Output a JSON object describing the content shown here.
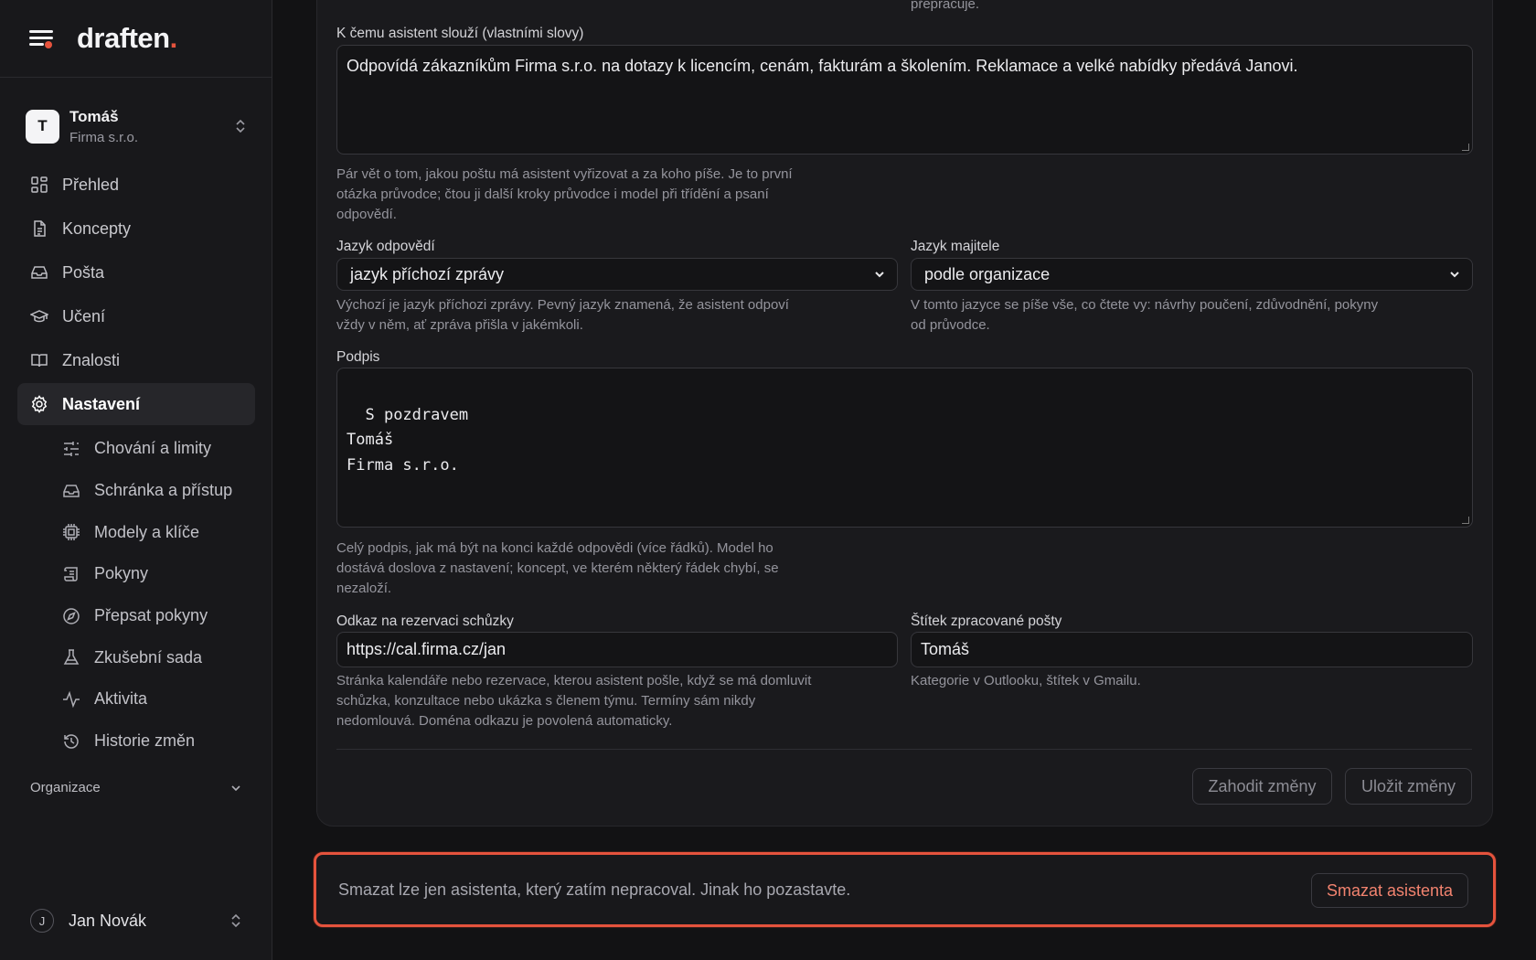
{
  "brand": {
    "name": "draften",
    "dot": "."
  },
  "account": {
    "initial": "T",
    "name": "Tomáš",
    "org": "Firma s.r.o."
  },
  "nav": [
    {
      "label": "Přehled",
      "icon": "dashboard-icon"
    },
    {
      "label": "Koncepty",
      "icon": "document-icon"
    },
    {
      "label": "Pošta",
      "icon": "inbox-icon"
    },
    {
      "label": "Učení",
      "icon": "graduation-cap-icon"
    },
    {
      "label": "Znalosti",
      "icon": "book-icon"
    },
    {
      "label": "Nastavení",
      "icon": "gear-icon",
      "active": true
    }
  ],
  "settings_sub": [
    {
      "label": "Chování a limity",
      "icon": "sliders-icon"
    },
    {
      "label": "Schránka a přístup",
      "icon": "inbox-icon"
    },
    {
      "label": "Modely a klíče",
      "icon": "chip-icon"
    },
    {
      "label": "Pokyny",
      "icon": "scroll-icon"
    },
    {
      "label": "Přepsat pokyny",
      "icon": "compass-icon"
    },
    {
      "label": "Zkušební sada",
      "icon": "flask-icon"
    },
    {
      "label": "Aktivita",
      "icon": "activity-icon"
    },
    {
      "label": "Historie změn",
      "icon": "history-icon"
    }
  ],
  "org_section": {
    "label": "Organizace"
  },
  "user": {
    "initial": "J",
    "name": "Jan Novák"
  },
  "form": {
    "top_fragment": "přepracuje.",
    "purpose": {
      "label": "K čemu asistent slouží (vlastními slovy)",
      "value": "Odpovídá zákazníkům Firma s.r.o. na dotazy k licencím, cenám, fakturám a školením. Reklamace a velké nabídky předává Janovi.",
      "hint": "Pár vět o tom, jakou poštu má asistent vyřizovat a za koho píše. Je to první otázka průvodce; čtou ji další kroky průvodce i model při třídění a psaní odpovědí."
    },
    "reply_language": {
      "label": "Jazyk odpovědí",
      "value": "jazyk příchozí zprávy",
      "hint": "Výchozí je jazyk příchozi zprávy. Pevný jazyk znamená, že asistent odpoví vždy v něm, ať zpráva přišla v jakémkoli."
    },
    "owner_language": {
      "label": "Jazyk majitele",
      "value": "podle organizace",
      "hint": "V tomto jazyce se píše vše, co čtete vy: návrhy poučení, zdůvodnění, pokyny od průvodce."
    },
    "signature": {
      "label": "Podpis",
      "value": "S pozdravem\nTomáš\nFirma s.r.o.",
      "hint": "Celý podpis, jak má být na konci každé odpovědi (více řádků). Model ho dostává doslova z nastavení; koncept, ve kterém některý řádek chybí, se nezaloží."
    },
    "booking_link": {
      "label": "Odkaz na rezervaci schůzky",
      "value": "https://cal.firma.cz/jan",
      "hint": "Stránka kalendáře nebo rezervace, kterou asistent pošle, když se má domluvit schůzka, konzultace nebo ukázka s členem týmu. Termíny sám nikdy nedomlouvá. Doména odkazu je povolená automaticky."
    },
    "processed_tag": {
      "label": "Štítek zpracované pošty",
      "value": "Tomáš",
      "hint": "Kategorie v Outlooku, štítek v Gmailu."
    },
    "discard_label": "Zahodit změny",
    "save_label": "Uložit změny"
  },
  "danger": {
    "text": "Smazat lze jen asistenta, který zatím nepracoval. Jinak ho pozastavte.",
    "button": "Smazat asistenta"
  },
  "colors": {
    "accent": "#e5533d",
    "background": "#121214",
    "sidebar": "#18181b"
  }
}
